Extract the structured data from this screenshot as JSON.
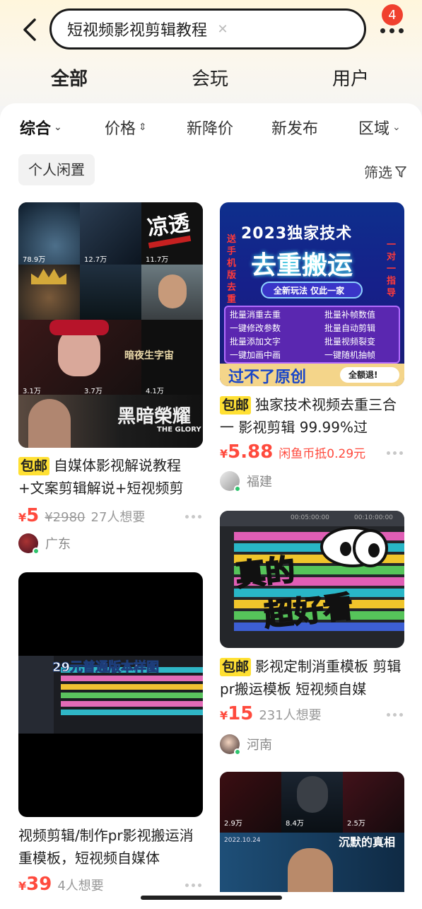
{
  "search": {
    "query": "短视频影视剪辑教程",
    "clear_icon": "close-icon"
  },
  "header": {
    "badge_count": "4"
  },
  "tabs": [
    {
      "label": "全部",
      "active": true
    },
    {
      "label": "会玩",
      "active": false
    },
    {
      "label": "用户",
      "active": false
    }
  ],
  "filters": [
    {
      "label": "综合",
      "suffix": "⌄"
    },
    {
      "label": "价格",
      "suffix": "⇕"
    },
    {
      "label": "新降价",
      "suffix": ""
    },
    {
      "label": "新发布",
      "suffix": ""
    },
    {
      "label": "区域",
      "suffix": "⌄"
    }
  ],
  "chip": "个人闲置",
  "screen_label": "筛选",
  "colors": {
    "accent": "#ffe033",
    "price": "#ff4a3d",
    "online": "#2ec46d"
  },
  "products": [
    {
      "img": {
        "stats": [
          "78.9万",
          "12.7万",
          "11.7万",
          "3.1万",
          "3.7万",
          "4.1万"
        ],
        "text_zuoge": "暗夜生字宙",
        "text_dark": "黑暗榮耀",
        "text_glory": "THE GLORY",
        "text_big": "凉透"
      },
      "tag": "包邮",
      "title": "自媒体影视解说教程+文案剪辑解说+短视频剪",
      "currency": "¥",
      "price": "5",
      "orig": "¥2980",
      "want": "27人想要",
      "location": "广东"
    },
    {
      "img": {
        "headline": "2023独家技术",
        "banner": "去重搬运",
        "subtitle": "全新玩法 仅此一家",
        "side_left": "送手机版去重",
        "side_right": "一对一指导",
        "features": [
          "批量消重去重",
          "批量补帧数值",
          "一键修改参数",
          "批量自动剪辑",
          "批量添加文字",
          "批量视频裂变",
          "一键加画中画",
          "一键随机抽帧"
        ],
        "footer": "过不了原创",
        "footer_badge": "全额退!"
      },
      "tag": "包邮",
      "title": "独家技术视频去重三合一 影视剪辑 99.99%过",
      "currency": "¥",
      "price": "5.88",
      "coin": "闲鱼币抵0.29元",
      "location": "福建"
    },
    {
      "img": {
        "line1": "真的",
        "line2": "超好看",
        "timeline1": "00:05:00:00",
        "timeline2": "00:10:00:00"
      },
      "tag": "包邮",
      "title": "影视定制消重模板 剪辑pr搬运模板 短视频自媒",
      "currency": "¥",
      "price": "15",
      "want": "231人想要",
      "location": "河南"
    },
    {
      "img": {
        "caption": "29元普通版本样图"
      },
      "title": "视频剪辑/制作pr影视搬运消重模板，短视频自媒体",
      "currency": "¥",
      "price": "39",
      "want": "4人想要"
    },
    {
      "img": {
        "stats": [
          "2.9万",
          "8.4万",
          "2.5万"
        ],
        "date": "2022.10.24",
        "title": "沉默的真相"
      }
    }
  ]
}
